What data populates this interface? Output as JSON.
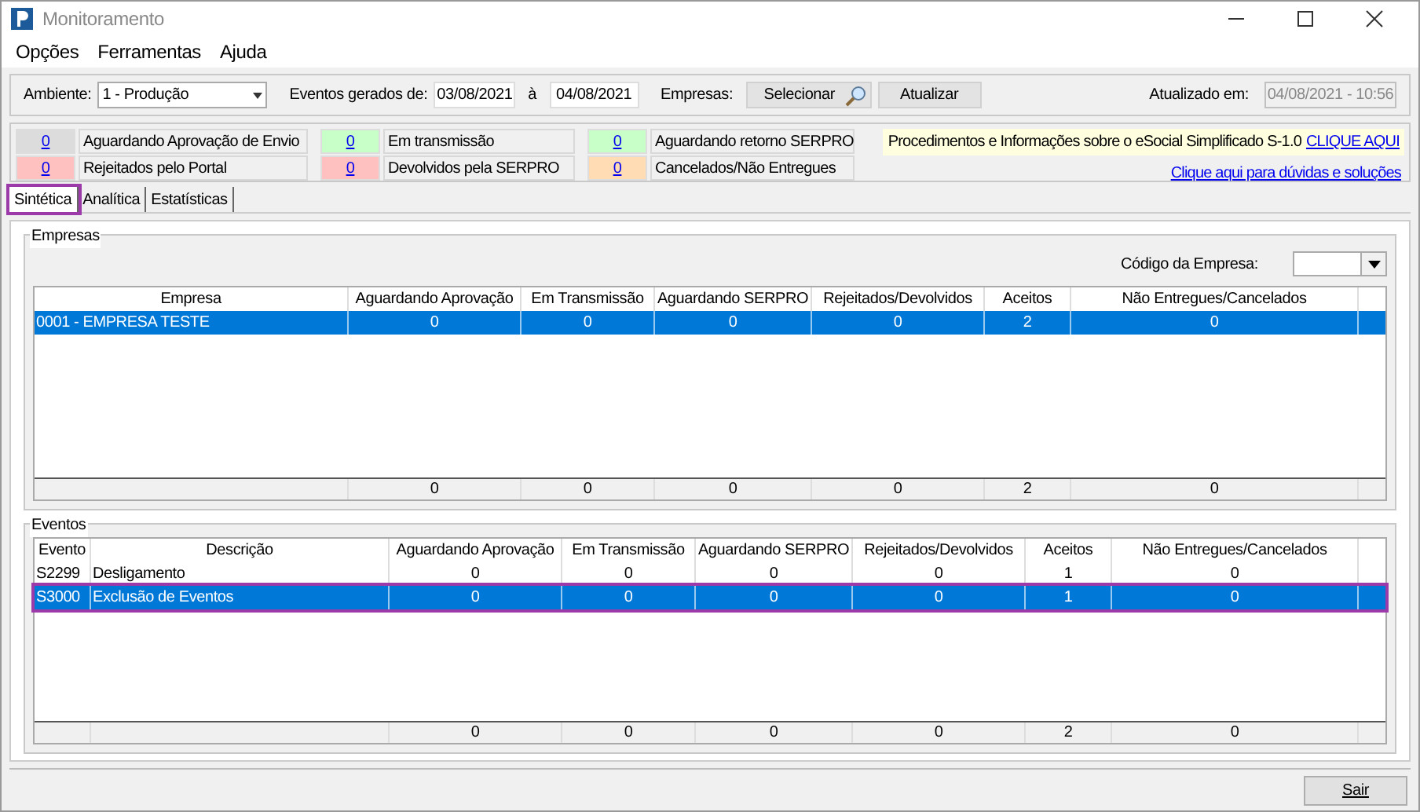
{
  "window": {
    "title": "Monitoramento"
  },
  "menu": [
    "Opções",
    "Ferramentas",
    "Ajuda"
  ],
  "toolbar": {
    "ambiente_label": "Ambiente:",
    "ambiente_value": "1 - Produção",
    "eventos_label": "Eventos gerados de:",
    "date_from": "03/08/2021",
    "date_sep": "à",
    "date_to": "04/08/2021",
    "empresas_label": "Empresas:",
    "select_button": "Selecionar",
    "update_button": "Atualizar",
    "updated_label": "Atualizado em:",
    "updated_value": "04/08/2021 - 10:56"
  },
  "counters": [
    {
      "count": "0",
      "label": "Aguardando Aprovação de Envio",
      "color": "#dcdcdc"
    },
    {
      "count": "0",
      "label": "Rejeitados pelo Portal",
      "color": "#ffc0c0"
    },
    {
      "count": "0",
      "label": "Em transmissão",
      "color": "#c8ffc8"
    },
    {
      "count": "0",
      "label": "Devolvidos pela SERPRO",
      "color": "#ffc0c0"
    },
    {
      "count": "0",
      "label": "Aguardando retorno SERPRO",
      "color": "#c8ffc8"
    },
    {
      "count": "0",
      "label": "Cancelados/Não Entregues",
      "color": "#ffdcb4"
    }
  ],
  "info": {
    "text": "Procedimentos e Informações sobre o eSocial Simplificado S-1.0",
    "link": "CLIQUE AQUI",
    "help_link": "Clique aqui para dúvidas e soluções"
  },
  "tabs": [
    {
      "label": "Sintética",
      "selected": true,
      "highlighted": true
    },
    {
      "label": "Analítica",
      "selected": false,
      "highlighted": false
    },
    {
      "label": "Estatísticas",
      "selected": false,
      "highlighted": false
    }
  ],
  "empresas": {
    "title": "Empresas",
    "code_label": "Código da Empresa:",
    "columns": [
      "Empresa",
      "Aguardando Aprovação",
      "Em Transmissão",
      "Aguardando SERPRO",
      "Rejeitados/Devolvidos",
      "Aceitos",
      "Não Entregues/Cancelados"
    ],
    "rows": [
      {
        "cells": [
          "0001 - EMPRESA TESTE",
          "0",
          "0",
          "0",
          "0",
          "2",
          "0"
        ],
        "selected": true,
        "highlighted": false
      }
    ],
    "totals": [
      "0",
      "0",
      "0",
      "0",
      "2",
      "0"
    ]
  },
  "eventos": {
    "title": "Eventos",
    "columns": [
      "Evento",
      "Descrição",
      "Aguardando Aprovação",
      "Em Transmissão",
      "Aguardando SERPRO",
      "Rejeitados/Devolvidos",
      "Aceitos",
      "Não Entregues/Cancelados"
    ],
    "rows": [
      {
        "cells": [
          "S2299",
          "Desligamento",
          "0",
          "0",
          "0",
          "0",
          "1",
          "0"
        ],
        "selected": false,
        "highlighted": false
      },
      {
        "cells": [
          "S3000",
          "Exclusão de Eventos",
          "0",
          "0",
          "0",
          "0",
          "1",
          "0"
        ],
        "selected": true,
        "highlighted": true
      }
    ],
    "totals": [
      "0",
      "0",
      "0",
      "0",
      "2",
      "0"
    ]
  },
  "exit_button": "Sair"
}
